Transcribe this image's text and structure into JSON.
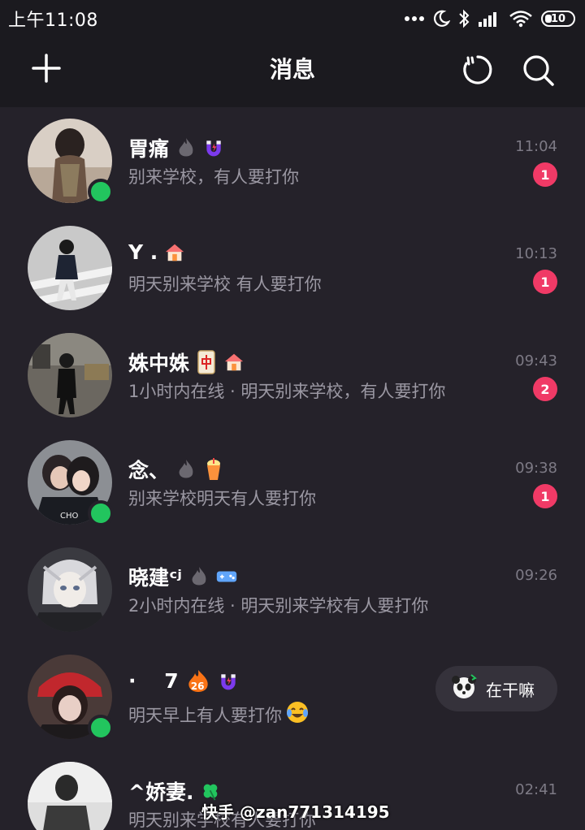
{
  "status_bar": {
    "time": "上午11:08",
    "battery": "10"
  },
  "header": {
    "title": "消息"
  },
  "conversations": [
    {
      "name": "胃痛",
      "preview": "别来学校，有人要打你",
      "time": "11:04",
      "unread": "1",
      "online": true
    },
    {
      "name": "Y .",
      "preview": "明天别来学校 有人要打你",
      "time": "10:13",
      "unread": "1",
      "online": false
    },
    {
      "name": "姝中姝",
      "preview": "1小时内在线 · 明天别来学校，有人要打你",
      "time": "09:43",
      "unread": "2",
      "online": false
    },
    {
      "name": "念、",
      "preview": "别来学校明天有人要打你",
      "time": "09:38",
      "unread": "1",
      "online": true
    },
    {
      "name": "晓建ᶜʲ",
      "preview": "2小时内在线 · 明天别来学校有人要打你",
      "time": "09:26",
      "unread": "",
      "online": false
    },
    {
      "name": "·    7",
      "preview": "明天早上有人要打你",
      "time": "",
      "unread": "",
      "online": true,
      "streak": "26",
      "quick_reply": "在干嘛"
    },
    {
      "name": "^娇妻.",
      "preview": "明天别来学校有人要打你",
      "time": "02:41",
      "unread": "",
      "online": false
    }
  ],
  "watermark": "快手 @zan771314195",
  "colors": {
    "background": "#25222a",
    "header": "#1b1a1f",
    "badge": "#f03a66",
    "online": "#22c55e"
  }
}
